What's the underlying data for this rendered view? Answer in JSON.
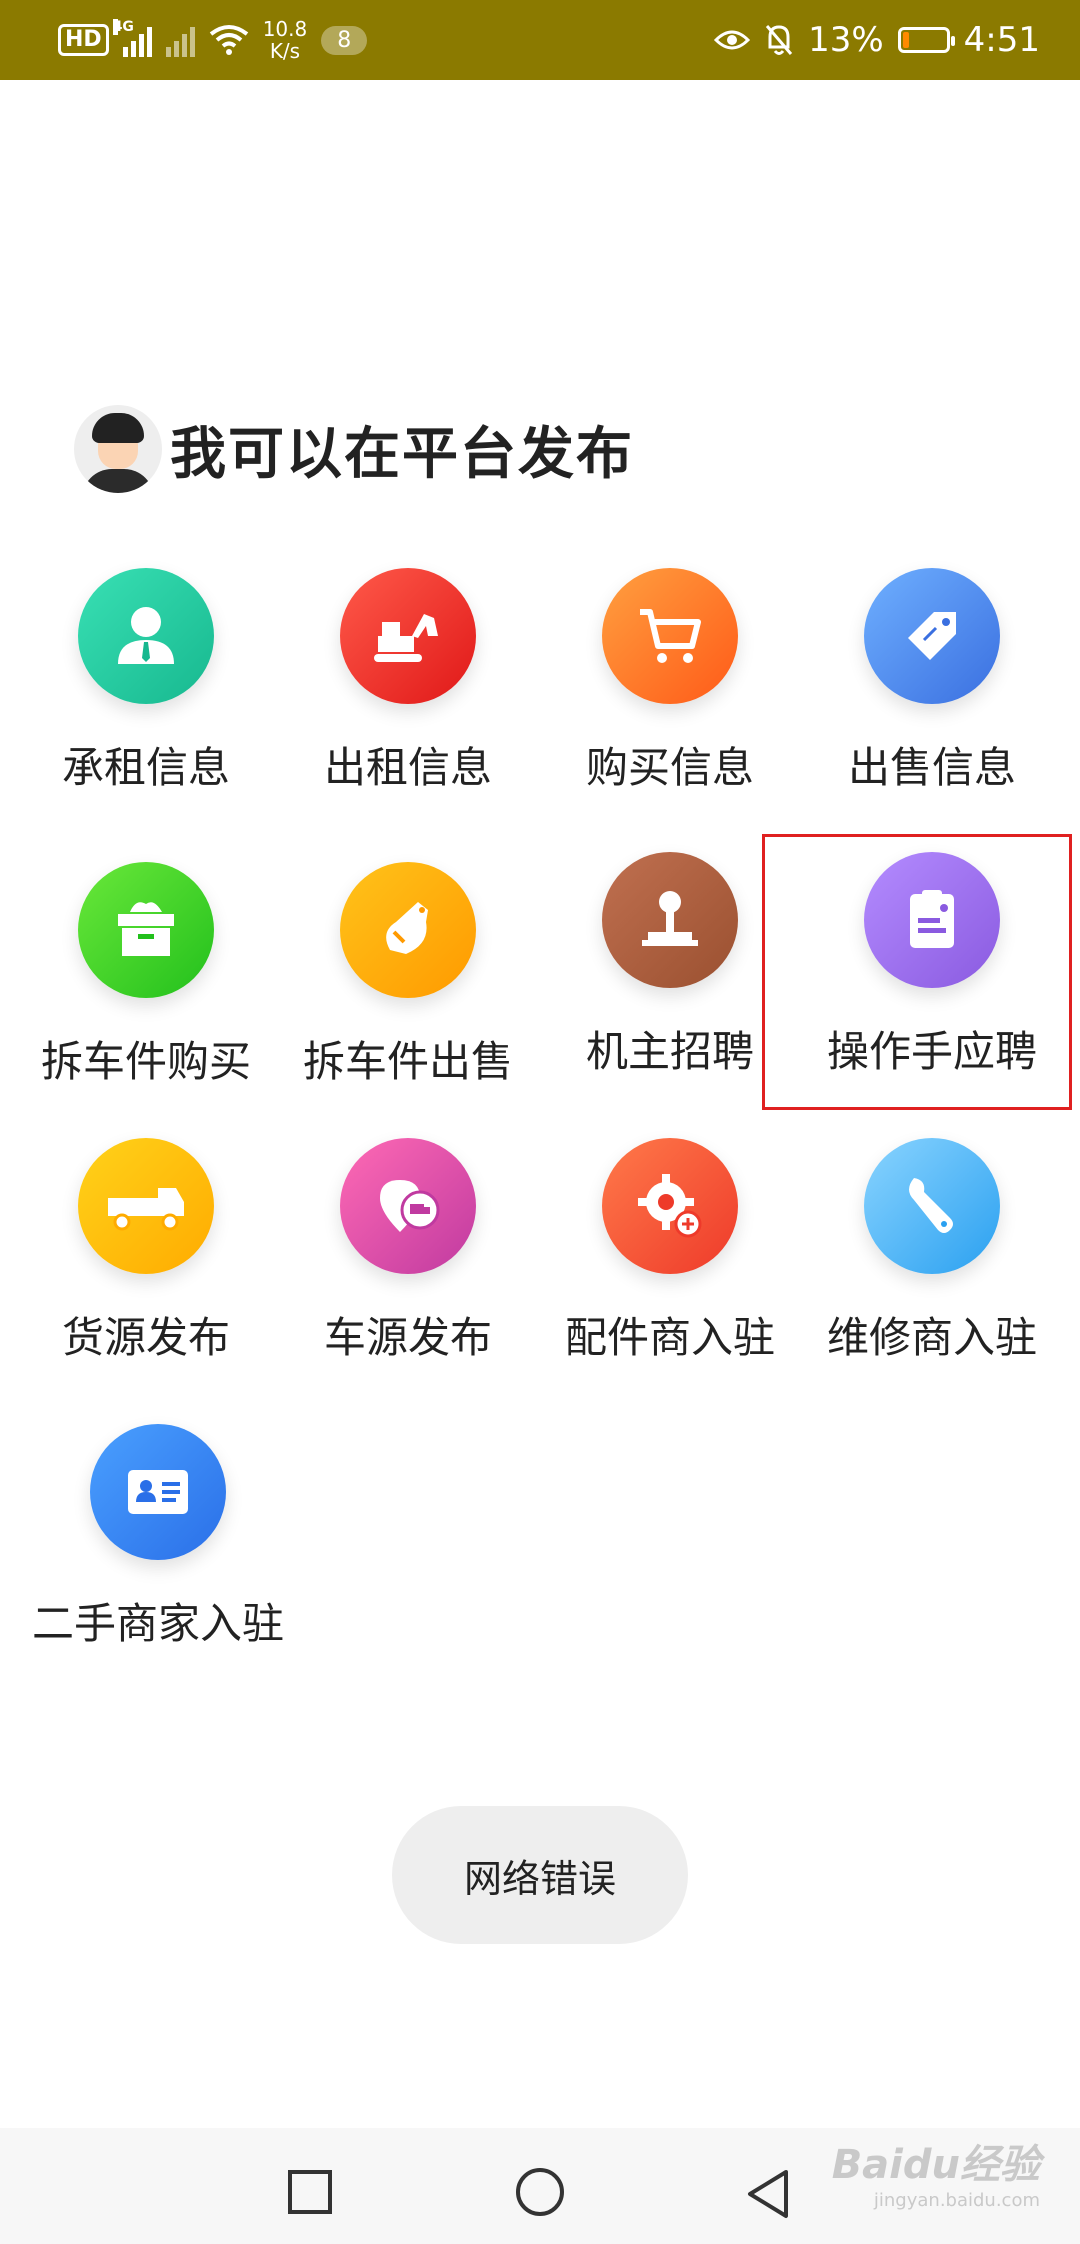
{
  "status_bar": {
    "hd": "HD",
    "net_type": "4G",
    "speed_value": "10.8",
    "speed_unit": "K/s",
    "notification_count": "8",
    "battery": "13%",
    "time": "4:51"
  },
  "page": {
    "title": "我可以在平台发布"
  },
  "items": [
    {
      "label": "承租信息"
    },
    {
      "label": "出租信息"
    },
    {
      "label": "购买信息"
    },
    {
      "label": "出售信息"
    },
    {
      "label": "拆车件购买"
    },
    {
      "label": "拆车件出售"
    },
    {
      "label": "机主招聘"
    },
    {
      "label": "操作手应聘"
    },
    {
      "label": "货源发布"
    },
    {
      "label": "车源发布"
    },
    {
      "label": "配件商入驻"
    },
    {
      "label": "维修商入驻"
    },
    {
      "label": "二手商家入驻"
    }
  ],
  "toast": {
    "text": "网络错误"
  },
  "watermark": {
    "text": "Baidu经验",
    "url": "jingyan.baidu.com"
  },
  "colors": {
    "status_bar": "#8b7a00",
    "highlight": "#e02020"
  }
}
